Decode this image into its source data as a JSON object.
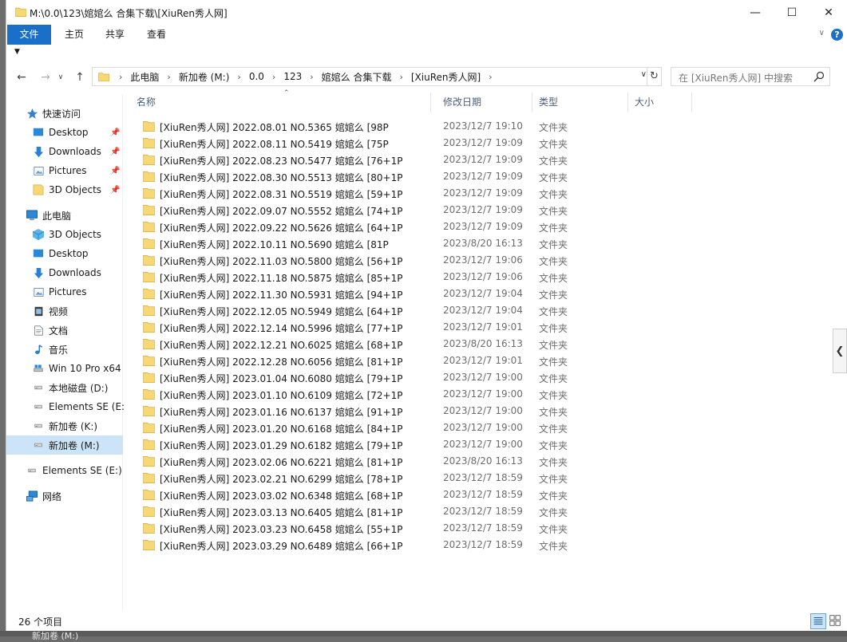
{
  "window": {
    "title": "M:\\0.0\\123\\婠婠么 合集下载\\[XiuRen秀人网]",
    "minimize_glyph": "—",
    "maximize_glyph": "☐",
    "close_glyph": "✕"
  },
  "ribbon": {
    "tabs": [
      "文件",
      "主页",
      "共享",
      "查看"
    ],
    "help": "?"
  },
  "address": {
    "crumbs": [
      "此电脑",
      "新加卷 (M:)",
      "0.0",
      "123",
      "婠婠么 合集下载",
      "[XiuRen秀人网]"
    ],
    "search_placeholder": "在 [XiuRen秀人网] 中搜索"
  },
  "navpane": {
    "quick_access": "快速访问",
    "quick_items": [
      {
        "label": "Desktop",
        "icon": "desktop-icon"
      },
      {
        "label": "Downloads",
        "icon": "download-icon"
      },
      {
        "label": "Pictures",
        "icon": "pictures-icon"
      },
      {
        "label": "3D Objects",
        "icon": "folder-icon"
      }
    ],
    "this_pc": "此电脑",
    "pc_items": [
      {
        "label": "3D Objects",
        "icon": "3d-objects-icon"
      },
      {
        "label": "Desktop",
        "icon": "desktop-icon"
      },
      {
        "label": "Downloads",
        "icon": "download-icon"
      },
      {
        "label": "Pictures",
        "icon": "pictures-icon"
      },
      {
        "label": "视频",
        "icon": "video-icon"
      },
      {
        "label": "文档",
        "icon": "document-icon"
      },
      {
        "label": "音乐",
        "icon": "music-icon"
      },
      {
        "label": "Win 10 Pro x64",
        "icon": "system-drive-icon"
      },
      {
        "label": "本地磁盘 (D:)",
        "icon": "drive-icon"
      },
      {
        "label": "Elements SE (E:",
        "icon": "drive-icon"
      },
      {
        "label": "新加卷 (K:)",
        "icon": "drive-icon"
      },
      {
        "label": "新加卷 (M:)",
        "icon": "drive-icon"
      }
    ],
    "external": "Elements SE (E:)",
    "network": "网络"
  },
  "columns": {
    "name": "名称",
    "date": "修改日期",
    "type": "类型",
    "size": "大小"
  },
  "files": [
    {
      "name": "[XiuRen秀人网] 2022.08.01 NO.5365 婠婠么 [98P",
      "date": "2023/12/7 19:10",
      "type": "文件夹"
    },
    {
      "name": "[XiuRen秀人网] 2022.08.11 NO.5419 婠婠么 [75P",
      "date": "2023/12/7 19:09",
      "type": "文件夹"
    },
    {
      "name": "[XiuRen秀人网] 2022.08.23 NO.5477 婠婠么 [76+1P",
      "date": "2023/12/7 19:09",
      "type": "文件夹"
    },
    {
      "name": "[XiuRen秀人网] 2022.08.30 NO.5513 婠婠么 [80+1P",
      "date": "2023/12/7 19:09",
      "type": "文件夹"
    },
    {
      "name": "[XiuRen秀人网] 2022.08.31 NO.5519 婠婠么 [59+1P",
      "date": "2023/12/7 19:09",
      "type": "文件夹"
    },
    {
      "name": "[XiuRen秀人网] 2022.09.07 NO.5552 婠婠么 [74+1P",
      "date": "2023/12/7 19:09",
      "type": "文件夹"
    },
    {
      "name": "[XiuRen秀人网] 2022.09.22 NO.5626 婠婠么 [64+1P",
      "date": "2023/12/7 19:09",
      "type": "文件夹"
    },
    {
      "name": "[XiuRen秀人网] 2022.10.11 NO.5690 婠婠么 [81P",
      "date": "2023/8/20 16:13",
      "type": "文件夹"
    },
    {
      "name": "[XiuRen秀人网] 2022.11.03 NO.5800 婠婠么 [56+1P",
      "date": "2023/12/7 19:06",
      "type": "文件夹"
    },
    {
      "name": "[XiuRen秀人网] 2022.11.18 NO.5875 婠婠么  [85+1P",
      "date": "2023/12/7 19:06",
      "type": "文件夹"
    },
    {
      "name": "[XiuRen秀人网] 2022.11.30 NO.5931 婠婠么 [94+1P",
      "date": "2023/12/7 19:04",
      "type": "文件夹"
    },
    {
      "name": "[XiuRen秀人网] 2022.12.05 NO.5949 婠婠么 [64+1P",
      "date": "2023/12/7 19:04",
      "type": "文件夹"
    },
    {
      "name": "[XiuRen秀人网] 2022.12.14 NO.5996 婠婠么 [77+1P",
      "date": "2023/12/7 19:01",
      "type": "文件夹"
    },
    {
      "name": "[XiuRen秀人网] 2022.12.21 NO.6025 婠婠么 [68+1P",
      "date": "2023/8/20 16:13",
      "type": "文件夹"
    },
    {
      "name": "[XiuRen秀人网] 2022.12.28 NO.6056 婠婠么 [81+1P",
      "date": "2023/12/7 19:01",
      "type": "文件夹"
    },
    {
      "name": "[XiuRen秀人网] 2023.01.04 NO.6080 婠婠么 [79+1P",
      "date": "2023/12/7 19:00",
      "type": "文件夹"
    },
    {
      "name": "[XiuRen秀人网] 2023.01.10 NO.6109 婠婠么 [72+1P",
      "date": "2023/12/7 19:00",
      "type": "文件夹"
    },
    {
      "name": "[XiuRen秀人网] 2023.01.16 NO.6137 婠婠么 [91+1P",
      "date": "2023/12/7 19:00",
      "type": "文件夹"
    },
    {
      "name": "[XiuRen秀人网] 2023.01.20 NO.6168 婠婠么 [84+1P",
      "date": "2023/12/7 19:00",
      "type": "文件夹"
    },
    {
      "name": "[XiuRen秀人网] 2023.01.29 NO.6182 婠婠么 [79+1P",
      "date": "2023/12/7 19:00",
      "type": "文件夹"
    },
    {
      "name": "[XiuRen秀人网] 2023.02.06 NO.6221 婠婠么 [81+1P",
      "date": "2023/8/20 16:13",
      "type": "文件夹"
    },
    {
      "name": "[XiuRen秀人网] 2023.02.21 NO.6299 婠婠么 [78+1P",
      "date": "2023/12/7 18:59",
      "type": "文件夹"
    },
    {
      "name": "[XiuRen秀人网] 2023.03.02 NO.6348 婠婠么 [68+1P",
      "date": "2023/12/7 18:59",
      "type": "文件夹"
    },
    {
      "name": "[XiuRen秀人网] 2023.03.13 NO.6405 婠婠么 [81+1P",
      "date": "2023/12/7 18:59",
      "type": "文件夹"
    },
    {
      "name": "[XiuRen秀人网] 2023.03.23 NO.6458 婠婠么 [55+1P",
      "date": "2023/12/7 18:59",
      "type": "文件夹"
    },
    {
      "name": "[XiuRen秀人网] 2023.03.29 NO.6489 婠婠么 [66+1P",
      "date": "2023/12/7 18:59",
      "type": "文件夹"
    }
  ],
  "status": {
    "count": "26 个项目"
  },
  "background": {
    "partial_text": "新加卷 (M:)"
  },
  "colors": {
    "accent": "#1a70c9",
    "selection": "#cce4f7",
    "folder": "#f8d775"
  }
}
